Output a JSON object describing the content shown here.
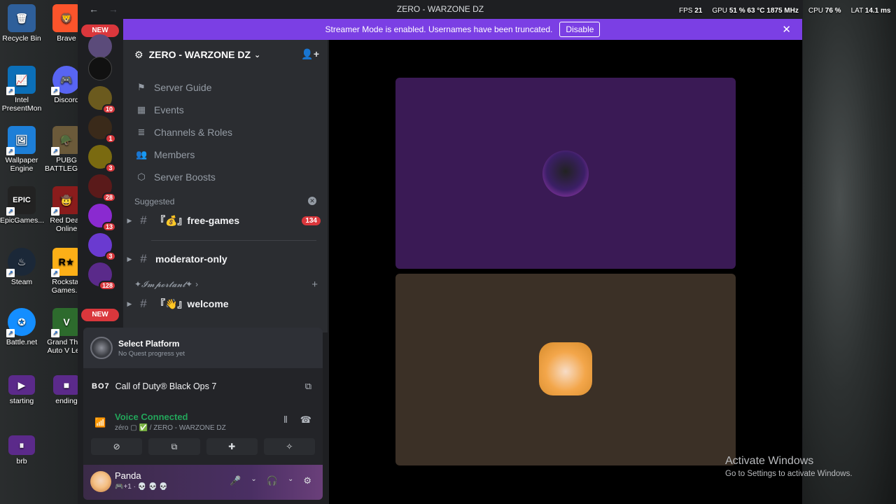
{
  "desktop": {
    "icons": [
      {
        "label": "Recycle Bin",
        "glyph": "🗑"
      },
      {
        "label": "Brave",
        "glyph": "🦁"
      },
      {
        "label": "Intel PresentMon",
        "glyph": "📈"
      },
      {
        "label": "Discord",
        "glyph": "🎮"
      },
      {
        "label": "Wallpaper Engine",
        "glyph": "🖼"
      },
      {
        "label": "PUBG BATTLEGR...",
        "glyph": "🪖"
      },
      {
        "label": "EpicGames...",
        "glyph": "EPIC"
      },
      {
        "label": "Red Dead Online",
        "glyph": "🤠"
      },
      {
        "label": "Steam",
        "glyph": "♨"
      },
      {
        "label": "Rockstar Games...",
        "glyph": "R★"
      },
      {
        "label": "Battle.net",
        "glyph": "✪"
      },
      {
        "label": "Grand Theft Auto V Le...",
        "glyph": "V"
      },
      {
        "label": "starting",
        "glyph": "▶"
      },
      {
        "label": "ending",
        "glyph": "■"
      },
      {
        "label": "brb",
        "glyph": "⏸"
      }
    ]
  },
  "overlay": {
    "fps_label": "FPS",
    "fps_value": "21",
    "gpu_label": "GPU",
    "gpu_value": "51 %  63 °C  1875 MHz",
    "cpu_label": "CPU",
    "cpu_value": "76 %",
    "lat_label": "LAT",
    "lat_value": "14.1 ms"
  },
  "window": {
    "title": "ZERO - WARZONE DZ",
    "back": "←",
    "forward": "→"
  },
  "banner": {
    "text": "Streamer Mode is enabled. Usernames have been truncated.",
    "disable_label": "Disable",
    "close": "✕"
  },
  "rail": {
    "new_label": "NEW",
    "servers": [
      {
        "badge": "",
        "color": "#5b4b7a"
      },
      {
        "badge": "",
        "color": "#111111"
      },
      {
        "badge": "10",
        "color": "#6b5a1e"
      },
      {
        "badge": "1",
        "color": "#3a2a1a"
      },
      {
        "badge": "3",
        "color": "#7a6a10"
      },
      {
        "badge": "28",
        "color": "#5a1a1a"
      },
      {
        "badge": "13",
        "color": "#8a2ad0"
      },
      {
        "badge": "3",
        "color": "#6a3ad0"
      },
      {
        "badge": "128",
        "color": "#5a2a8a"
      }
    ]
  },
  "sidebar": {
    "server_name": "ZERO - WARZONE DZ",
    "menu": [
      {
        "label": "Server Guide",
        "icon": "⚑"
      },
      {
        "label": "Events",
        "icon": "▦"
      },
      {
        "label": "Channels & Roles",
        "icon": "≣"
      },
      {
        "label": "Members",
        "icon": "👥"
      },
      {
        "label": "Server Boosts",
        "icon": "⬡"
      }
    ],
    "suggested_label": "Suggested",
    "channels": [
      {
        "name": "『💰』free-games",
        "count": "134"
      },
      {
        "name": "moderator-only",
        "count": ""
      }
    ],
    "category": "✦𝓘𝓶𝓹𝓸𝓻𝓽𝓪𝓷𝓽✦",
    "welcome": "『👋』welcome",
    "new_label": "NEW"
  },
  "quest": {
    "title": "Select Platform",
    "subtitle": "No Quest progress yet"
  },
  "game": {
    "logo": "BO7",
    "title": "Call of Duty® Black Ops 7"
  },
  "voice": {
    "title": "Voice Connected",
    "subtitle": "zéro ▢ ✅ / ZERO - WARZONE DZ"
  },
  "user": {
    "name": "Panda",
    "status": "🎮+1 · 💀 💀 💀"
  },
  "windows_watermark": {
    "line1": "Activate Windows",
    "line2": "Go to Settings to activate Windows."
  }
}
